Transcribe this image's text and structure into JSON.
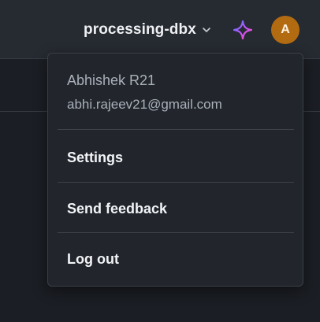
{
  "header": {
    "workspace_name": "processing-dbx",
    "avatar_initial": "A"
  },
  "user_menu": {
    "name": "Abhishek R21",
    "email": "abhi.rajeev21@gmail.com",
    "items": [
      {
        "label": "Settings"
      },
      {
        "label": "Send feedback"
      },
      {
        "label": "Log out"
      }
    ]
  },
  "colors": {
    "avatar": "#b36b12",
    "sparkle_gradient": [
      "#4f7dff",
      "#c84fff",
      "#ff5aa8"
    ]
  },
  "icons": {
    "chevron": "chevron-down-icon",
    "assistant": "sparkle-icon"
  }
}
